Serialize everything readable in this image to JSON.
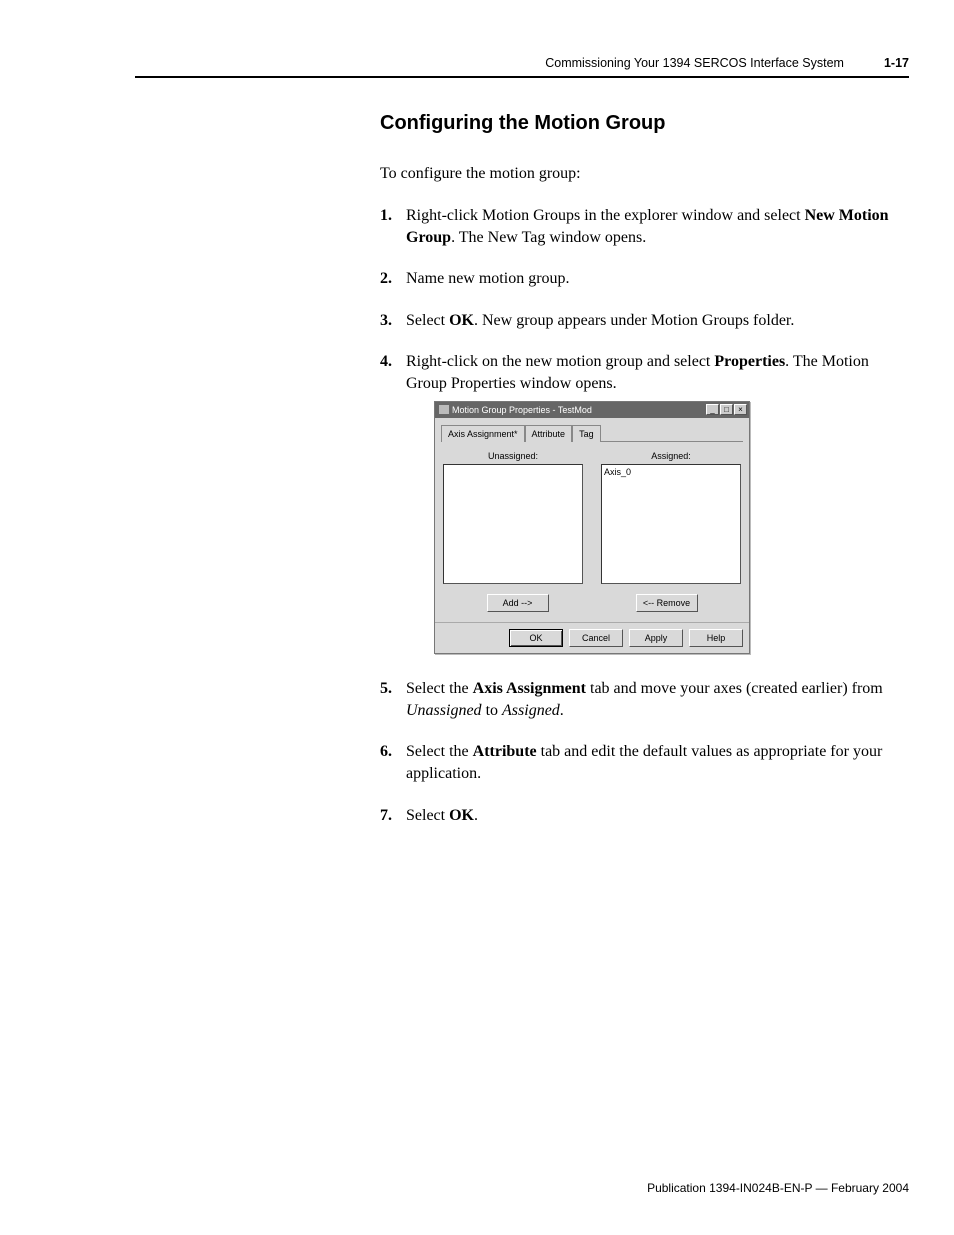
{
  "header": {
    "title": "Commissioning Your 1394 SERCOS Interface System",
    "page": "1-17"
  },
  "section_title": "Configuring the Motion Group",
  "lead": "To configure the motion group:",
  "steps": {
    "s1a": "Right-click Motion Groups in the explorer window and select ",
    "s1b": "New Motion Group",
    "s1c": ". The New Tag window opens.",
    "s2": "Name new motion group.",
    "s3a": "Select ",
    "s3b": "OK",
    "s3c": ". New group appears under Motion Groups folder.",
    "s4a": "Right-click on the new motion group and select ",
    "s4b": "Properties",
    "s4c": ". The Motion Group Properties window opens.",
    "s5a": "Select the ",
    "s5b": "Axis Assignment",
    "s5c": " tab and move your axes (created earlier) from ",
    "s5d": "Unassigned",
    "s5e": " to ",
    "s5f": "Assigned",
    "s5g": ".",
    "s6a": "Select the ",
    "s6b": "Attribute",
    "s6c": " tab and edit the default values as appropriate for your application.",
    "s7a": "Select ",
    "s7b": "OK",
    "s7c": "."
  },
  "dialog": {
    "title": "Motion Group Properties - TestMod",
    "tabs": {
      "t1": "Axis Assignment*",
      "t2": "Attribute",
      "t3": "Tag"
    },
    "labels": {
      "unassigned": "Unassigned:",
      "assigned": "Assigned:"
    },
    "assigned_item": "Axis_0",
    "buttons": {
      "add": "Add -->",
      "remove": "<-- Remove",
      "ok": "OK",
      "cancel": "Cancel",
      "apply": "Apply",
      "help": "Help"
    }
  },
  "publication": "Publication 1394-IN024B-EN-P — February 2004"
}
